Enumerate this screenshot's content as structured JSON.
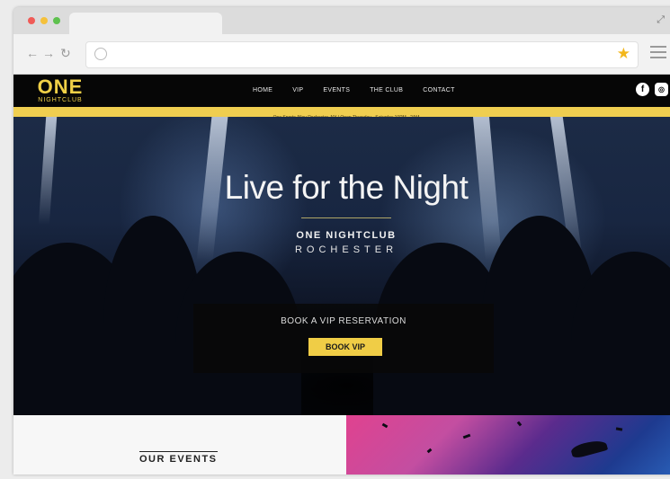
{
  "browser": {
    "nav": {
      "back": "←",
      "forward": "→",
      "reload": "↻"
    },
    "url": ""
  },
  "site": {
    "logo": {
      "main": "ONE",
      "sub": "NIGHTCLUB"
    },
    "nav": [
      "HOME",
      "VIP",
      "EVENTS",
      "THE CLUB",
      "CONTACT"
    ],
    "social": {
      "facebook": "f",
      "instagram": "◎"
    },
    "info_bar": "One Sports Alley Rochester, NY | Open Thursday - Saturday 10PM - 2AM",
    "hero": {
      "title": "Live for the Night",
      "subtitle_1": "ONE NIGHTCLUB",
      "subtitle_2": "ROCHESTER",
      "vip_label": "BOOK A VIP RESERVATION",
      "vip_button": "BOOK VIP"
    },
    "events_title": "OUR EVENTS"
  },
  "colors": {
    "accent": "#efce50",
    "header": "#060606"
  }
}
